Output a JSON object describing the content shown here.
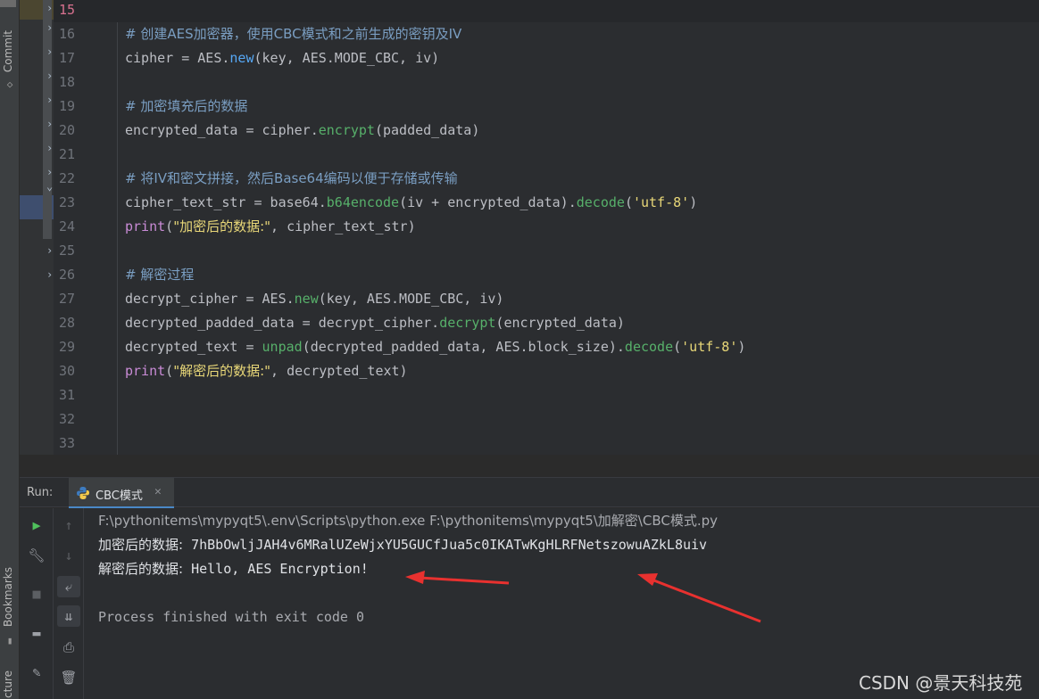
{
  "left_strip": {
    "commit_label": "Commit",
    "bookmarks_label": "Bookmarks",
    "structure_label": "Structure"
  },
  "editor": {
    "active_line": "15",
    "lines": [
      {
        "n": "15",
        "parts": []
      },
      {
        "n": "16",
        "parts": [
          {
            "c": "comment",
            "t": "# 创建AES加密器，使用CBC模式和之前生成的密钥及IV"
          }
        ]
      },
      {
        "n": "17",
        "parts": [
          {
            "c": "plain",
            "t": "cipher = AES."
          },
          {
            "c": "func",
            "t": "new"
          },
          {
            "c": "plain",
            "t": "(key, AES.MODE_CBC, iv)"
          }
        ]
      },
      {
        "n": "18",
        "parts": []
      },
      {
        "n": "19",
        "parts": [
          {
            "c": "comment",
            "t": "# 加密填充后的数据"
          }
        ]
      },
      {
        "n": "20",
        "parts": [
          {
            "c": "plain",
            "t": "encrypted_data = cipher."
          },
          {
            "c": "call",
            "t": "encrypt"
          },
          {
            "c": "plain",
            "t": "(padded_data)"
          }
        ]
      },
      {
        "n": "21",
        "parts": []
      },
      {
        "n": "22",
        "parts": [
          {
            "c": "comment",
            "t": "# 将IV和密文拼接，然后Base64编码以便于存储或传输"
          }
        ]
      },
      {
        "n": "23",
        "parts": [
          {
            "c": "plain",
            "t": "cipher_text_str = base64."
          },
          {
            "c": "call",
            "t": "b64encode"
          },
          {
            "c": "plain",
            "t": "(iv + encrypted_data)."
          },
          {
            "c": "call",
            "t": "decode"
          },
          {
            "c": "plain",
            "t": "("
          },
          {
            "c": "str",
            "t": "'utf-8'"
          },
          {
            "c": "plain",
            "t": ")"
          }
        ]
      },
      {
        "n": "24",
        "parts": [
          {
            "c": "builtin",
            "t": "print"
          },
          {
            "c": "plain",
            "t": "("
          },
          {
            "c": "str2",
            "t": "\"加密后的数据:\""
          },
          {
            "c": "plain",
            "t": ", cipher_text_str)"
          }
        ]
      },
      {
        "n": "25",
        "parts": []
      },
      {
        "n": "26",
        "parts": [
          {
            "c": "comment",
            "t": "# 解密过程"
          }
        ]
      },
      {
        "n": "27",
        "parts": [
          {
            "c": "plain",
            "t": "decrypt_cipher = AES."
          },
          {
            "c": "call",
            "t": "new"
          },
          {
            "c": "plain",
            "t": "(key, AES.MODE_CBC, iv)"
          }
        ]
      },
      {
        "n": "28",
        "parts": [
          {
            "c": "plain",
            "t": "decrypted_padded_data = decrypt_cipher."
          },
          {
            "c": "call",
            "t": "decrypt"
          },
          {
            "c": "plain",
            "t": "(encrypted_data)"
          }
        ]
      },
      {
        "n": "29",
        "parts": [
          {
            "c": "plain",
            "t": "decrypted_text = "
          },
          {
            "c": "call",
            "t": "unpad"
          },
          {
            "c": "plain",
            "t": "(decrypted_padded_data, AES.block_size)."
          },
          {
            "c": "call",
            "t": "decode"
          },
          {
            "c": "plain",
            "t": "("
          },
          {
            "c": "str",
            "t": "'utf-8'"
          },
          {
            "c": "plain",
            "t": ")"
          }
        ]
      },
      {
        "n": "30",
        "parts": [
          {
            "c": "builtin",
            "t": "print"
          },
          {
            "c": "plain",
            "t": "("
          },
          {
            "c": "str2",
            "t": "\"解密后的数据:\""
          },
          {
            "c": "plain",
            "t": ", decrypted_text)"
          }
        ]
      },
      {
        "n": "31",
        "parts": []
      },
      {
        "n": "32",
        "parts": []
      },
      {
        "n": "33",
        "parts": []
      }
    ]
  },
  "run_panel": {
    "label": "Run:",
    "tab_name": "CBC模式",
    "tab_close": "✕",
    "console": {
      "command": "F:\\pythonitems\\mypyqt5\\.env\\Scripts\\python.exe F:\\pythonitems\\mypyqt5\\加解密\\CBC模式.py",
      "encrypted_label": "加密后的数据:",
      "encrypted_value": " 7hBbOwljJAH4v6MRalUZeWjxYU5GUCfJua5c0IKATwKgHLRFNetszowuAZkL8uiv",
      "decrypted_label": "解密后的数据:",
      "decrypted_value": " Hello, AES Encryption!",
      "exit_message": "Process finished with exit code 0"
    }
  },
  "annotation": {
    "arrow_color": "#e8312f"
  },
  "watermark": "CSDN @景天科技苑"
}
